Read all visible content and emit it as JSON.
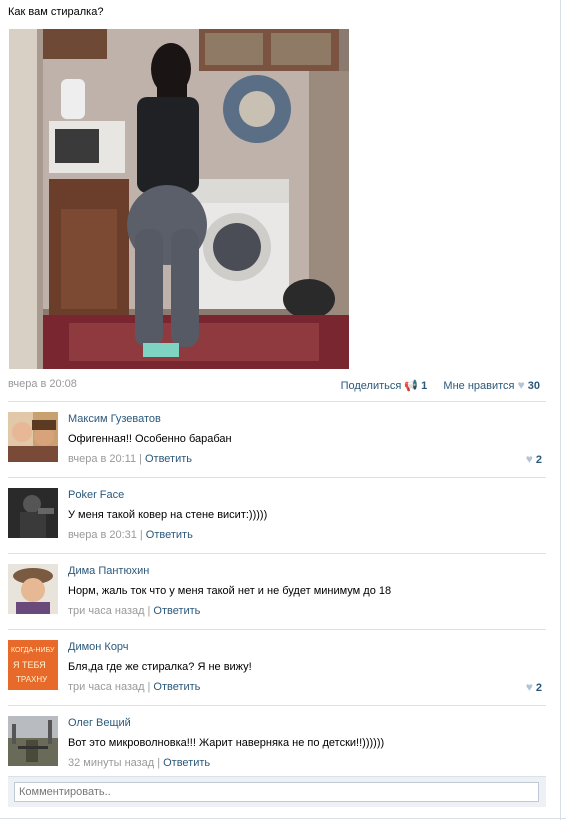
{
  "post": {
    "text": "Как вам стиралка?",
    "date": "вчера в 20:08",
    "share_label": "Поделиться",
    "share_count": "1",
    "like_label": "Мне нравится",
    "like_count": "30"
  },
  "comments": [
    {
      "name": "Максим Гузеватов",
      "text": "Офигенная!! Особенно барабан",
      "time": "вчера в 20:11",
      "reply": "Ответить",
      "likes": "2"
    },
    {
      "name": "Poker Face",
      "text": "У меня такой ковер на стене висит:)))))",
      "time": "вчера в 20:31",
      "reply": "Ответить",
      "likes": ""
    },
    {
      "name": "Дима Пантюхин",
      "text": "Норм, жаль ток что у меня такой нет и не будет минимум до 18",
      "time": "три часа назад",
      "reply": "Ответить",
      "likes": ""
    },
    {
      "name": "Димон Корч",
      "text": "Бля,да где же стиралка? Я не вижу!",
      "time": "три часа назад",
      "reply": "Ответить",
      "likes": "2"
    },
    {
      "name": "Олег Вещий",
      "text": "Вот это микроволновка!!! Жарит наверняка не по детски!!))))))",
      "time": "32 минуты назад",
      "reply": "Ответить",
      "likes": ""
    }
  ],
  "avatar3_text": [
    "КОГДА-НИБУ",
    "Я ТЕБЯ",
    "ТРАХНУ"
  ],
  "reply_box": {
    "placeholder": "Комментировать.."
  },
  "colors": {
    "link": "#2b587a",
    "muted": "#999999",
    "divider": "#dae1e8",
    "heart": "#b3c4d6"
  }
}
